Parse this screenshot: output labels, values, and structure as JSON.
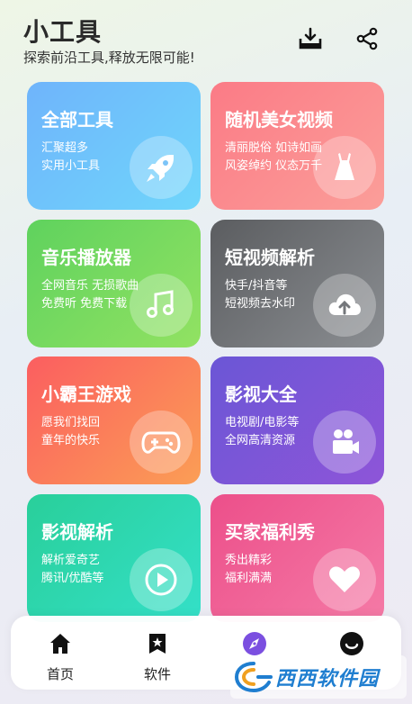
{
  "header": {
    "title": "小工具",
    "subtitle": "探索前沿工具,释放无限可能!",
    "download_icon": "download-tray-icon",
    "share_icon": "share-icon"
  },
  "cards": [
    {
      "title": "全部工具",
      "desc1": "汇聚超多",
      "desc2": "实用小工具",
      "icon": "rocket-icon"
    },
    {
      "title": "随机美女视频",
      "desc1": "清丽脱俗 如诗如画",
      "desc2": "风姿绰约 仪态万千",
      "icon": "dress-icon"
    },
    {
      "title": "音乐播放器",
      "desc1": "全网音乐 无损歌曲",
      "desc2": "免费听 免费下载",
      "icon": "music-note-icon"
    },
    {
      "title": "短视频解析",
      "desc1": "快手/抖音等",
      "desc2": "短视频去水印",
      "icon": "cloud-upload-icon"
    },
    {
      "title": "小霸王游戏",
      "desc1": "愿我们找回",
      "desc2": "童年的快乐",
      "icon": "gamepad-icon"
    },
    {
      "title": "影视大全",
      "desc1": "电视剧/电影等",
      "desc2": "全网高清资源",
      "icon": "video-camera-icon"
    },
    {
      "title": "影视解析",
      "desc1": "解析爱奇艺",
      "desc2": "腾讯/优酷等",
      "icon": "play-icon"
    },
    {
      "title": "买家福利秀",
      "desc1": "秀出精彩",
      "desc2": "福利满满",
      "icon": "heart-icon"
    }
  ],
  "tabs": [
    {
      "label": "首页",
      "icon": "home-icon"
    },
    {
      "label": "软件",
      "icon": "bookmark-star-icon"
    },
    {
      "label": "",
      "icon": "compass-icon"
    },
    {
      "label": "",
      "icon": "smiley-face-icon"
    }
  ],
  "watermark": {
    "text": "西西软件园",
    "logo": "cr173-logo"
  },
  "colors": {
    "accent_purple": "#7b4fe0",
    "text_dark": "#2a2a2a"
  }
}
